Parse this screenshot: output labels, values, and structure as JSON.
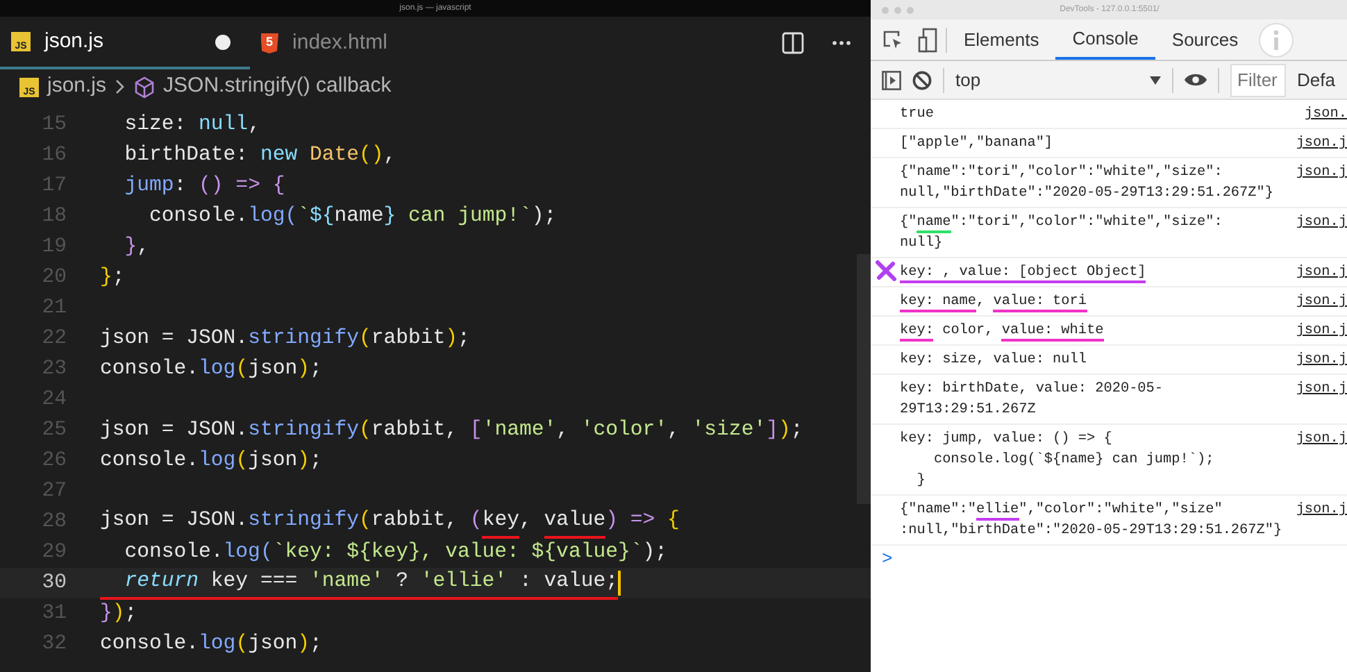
{
  "window": {
    "title": "json.js — javascript"
  },
  "editor": {
    "tabs": [
      {
        "label": "json.js",
        "icon": "JS",
        "selected": true,
        "modified": true
      },
      {
        "label": "index.html",
        "icon": "5",
        "selected": false,
        "modified": false
      }
    ],
    "breadcrumb": [
      {
        "label": "json.js",
        "icon": "JS"
      },
      {
        "label": "JSON.stringify() callback"
      }
    ],
    "lines": [
      {
        "number": "15",
        "current": false,
        "tokens": [
          {
            "text": "  size: ",
            "kind": "plain"
          },
          {
            "text": "null",
            "kind": "const"
          },
          {
            "text": ",",
            "kind": "plain"
          }
        ]
      },
      {
        "number": "16",
        "current": false,
        "tokens": [
          {
            "text": "  birthDate: ",
            "kind": "plain"
          },
          {
            "text": "new ",
            "kind": "const"
          },
          {
            "text": "Date",
            "kind": "cls"
          },
          {
            "text": "()",
            "kind": "brk"
          },
          {
            "text": ",",
            "kind": "plain"
          }
        ]
      },
      {
        "number": "17",
        "current": false,
        "tokens": [
          {
            "text": "  jump",
            "kind": "func"
          },
          {
            "text": ": ",
            "kind": "plain"
          },
          {
            "text": "() => {",
            "kind": "kw"
          }
        ]
      },
      {
        "number": "18",
        "current": false,
        "tokens": [
          {
            "text": "    console.",
            "kind": "plain"
          },
          {
            "text": "log",
            "kind": "func"
          },
          {
            "text": "(",
            "kind": "blue"
          },
          {
            "text": "`",
            "kind": "str"
          },
          {
            "text": "${",
            "kind": "const"
          },
          {
            "text": "name",
            "kind": "plain"
          },
          {
            "text": "}",
            "kind": "const"
          },
          {
            "text": " can jump!`",
            "kind": "str"
          },
          {
            "text": ");",
            "kind": "plain"
          }
        ]
      },
      {
        "number": "19",
        "current": false,
        "tokens": [
          {
            "text": "  }",
            "kind": "kw"
          },
          {
            "text": ",",
            "kind": "plain"
          }
        ]
      },
      {
        "number": "20",
        "current": false,
        "tokens": [
          {
            "text": "}",
            "kind": "brk"
          },
          {
            "text": ";",
            "kind": "plain"
          }
        ]
      },
      {
        "number": "21",
        "current": false
      },
      {
        "number": "22",
        "current": false,
        "tokens": [
          {
            "text": "json = JSON.",
            "kind": "plain"
          },
          {
            "text": "stringify",
            "kind": "func"
          },
          {
            "text": "(",
            "kind": "brk"
          },
          {
            "text": "rabbit",
            "kind": "plain"
          },
          {
            "text": ")",
            "kind": "brk"
          },
          {
            "text": ";",
            "kind": "plain"
          }
        ]
      },
      {
        "number": "23",
        "current": false,
        "tokens": [
          {
            "text": "console.",
            "kind": "plain"
          },
          {
            "text": "log",
            "kind": "func"
          },
          {
            "text": "(",
            "kind": "brk"
          },
          {
            "text": "json",
            "kind": "plain"
          },
          {
            "text": ")",
            "kind": "brk"
          },
          {
            "text": ";",
            "kind": "plain"
          }
        ]
      },
      {
        "number": "24",
        "current": false
      },
      {
        "number": "25",
        "current": false,
        "tokens": [
          {
            "text": "json = JSON.",
            "kind": "plain"
          },
          {
            "text": "stringify",
            "kind": "func"
          },
          {
            "text": "(",
            "kind": "brk"
          },
          {
            "text": "rabbit, ",
            "kind": "plain"
          },
          {
            "text": "[",
            "kind": "kw"
          },
          {
            "text": "'name'",
            "kind": "str"
          },
          {
            "text": ", ",
            "kind": "plain"
          },
          {
            "text": "'color'",
            "kind": "str"
          },
          {
            "text": ", ",
            "kind": "plain"
          },
          {
            "text": "'size'",
            "kind": "str"
          },
          {
            "text": "]",
            "kind": "kw"
          },
          {
            "text": ")",
            "kind": "brk"
          },
          {
            "text": ";",
            "kind": "plain"
          }
        ]
      },
      {
        "number": "26",
        "current": false,
        "tokens": [
          {
            "text": "console.",
            "kind": "plain"
          },
          {
            "text": "log",
            "kind": "func"
          },
          {
            "text": "(",
            "kind": "brk"
          },
          {
            "text": "json",
            "kind": "plain"
          },
          {
            "text": ")",
            "kind": "brk"
          },
          {
            "text": ";",
            "kind": "plain"
          }
        ]
      },
      {
        "number": "27",
        "current": false
      },
      {
        "number": "28",
        "current": false,
        "tokens": [
          {
            "text": "json = JSON.",
            "kind": "plain"
          },
          {
            "text": "stringify",
            "kind": "func"
          },
          {
            "text": "(",
            "kind": "brk"
          },
          {
            "text": "rabbit, ",
            "kind": "plain"
          },
          {
            "text": "(",
            "kind": "kw"
          },
          {
            "text": "key",
            "kind": "plain",
            "color": "#e8141b"
          },
          {
            "text": ", ",
            "kind": "plain"
          },
          {
            "text": "value",
            "kind": "plain",
            "color": "#e8141b"
          },
          {
            "text": ") => ",
            "kind": "kw"
          },
          {
            "text": "{",
            "kind": "brk"
          }
        ]
      },
      {
        "number": "29",
        "current": false,
        "tokens": [
          {
            "text": "  console.",
            "kind": "plain"
          },
          {
            "text": "log",
            "kind": "func"
          },
          {
            "text": "(",
            "kind": "blue"
          },
          {
            "text": "`key: ${key}, value: ${value}`",
            "kind": "str"
          },
          {
            "text": ");",
            "kind": "plain"
          }
        ]
      },
      {
        "number": "30",
        "current": true,
        "color": "#e8141b",
        "tokens": [
          {
            "text": "  return",
            "kind": "ret"
          },
          {
            "text": " key === ",
            "kind": "plain"
          },
          {
            "text": "'name'",
            "kind": "str"
          },
          {
            "text": " ? ",
            "kind": "plain"
          },
          {
            "text": "'ellie'",
            "kind": "str"
          },
          {
            "text": " : value;",
            "kind": "plain"
          }
        ]
      },
      {
        "number": "31",
        "current": false,
        "tokens": [
          {
            "text": "}",
            "kind": "kw"
          },
          {
            "text": ")",
            "kind": "brk"
          },
          {
            "text": ";",
            "kind": "plain"
          }
        ]
      },
      {
        "number": "32",
        "current": false,
        "tokens": [
          {
            "text": "console.",
            "kind": "plain"
          },
          {
            "text": "log",
            "kind": "func"
          },
          {
            "text": "(",
            "kind": "brk"
          },
          {
            "text": "json",
            "kind": "plain"
          },
          {
            "text": ")",
            "kind": "brk"
          },
          {
            "text": ";",
            "kind": "plain"
          }
        ]
      }
    ]
  },
  "devtools": {
    "title": "DevTools - 127.0.0.1:5501/",
    "tabs": [
      {
        "label": "Elements",
        "selected": false
      },
      {
        "label": "Console",
        "selected": true
      },
      {
        "label": "Sources",
        "selected": false
      }
    ],
    "context": "top",
    "filter": {
      "placeholder": "Filter"
    },
    "levels": "Defa",
    "messages": [
      {
        "marked": false,
        "source": "json.",
        "lines": [
          [
            {
              "text": "true"
            }
          ]
        ]
      },
      {
        "marked": false,
        "source": "json.j",
        "lines": [
          [
            {
              "text": "[\"apple\",\"banana\"]"
            }
          ]
        ]
      },
      {
        "marked": false,
        "source": "json.j",
        "lines": [
          [
            {
              "text": "{\"name\":\"tori\",\"color\":\"white\",\"size\":"
            }
          ],
          [
            {
              "text": "null,\"birthDate\":\"2020-05-29T13:29:51.267Z\"}"
            }
          ]
        ]
      },
      {
        "marked": false,
        "source": "json.j",
        "lines": [
          [
            {
              "text": "{\""
            },
            {
              "text": "name",
              "color": "#2ee06a"
            },
            {
              "text": "\":\"tori\",\"color\":\"white\",\"size\":"
            }
          ],
          [
            {
              "text": "null}"
            }
          ]
        ]
      },
      {
        "marked": true,
        "source": "json.j",
        "lines": [
          [
            {
              "text": "key: , value: [object Object]",
              "color": "#c43cf0"
            }
          ]
        ]
      },
      {
        "marked": false,
        "source": "json.j",
        "lines": [
          [
            {
              "text": "key: name",
              "color": "#f032c8"
            },
            {
              "text": ", "
            },
            {
              "text": "value: tori",
              "color": "#f032c8"
            }
          ]
        ]
      },
      {
        "marked": false,
        "source": "json.j",
        "lines": [
          [
            {
              "text": "key:",
              "color": "#f032c8"
            },
            {
              "text": " color, "
            },
            {
              "text": "value: white",
              "color": "#f032c8"
            }
          ]
        ]
      },
      {
        "marked": false,
        "source": "json.j",
        "lines": [
          [
            {
              "text": "key: size, value: null"
            }
          ]
        ]
      },
      {
        "marked": false,
        "source": "json.j",
        "lines": [
          [
            {
              "text": "key: birthDate, value: 2020-05-"
            }
          ],
          [
            {
              "text": "29T13:29:51.267Z"
            }
          ]
        ]
      },
      {
        "marked": false,
        "source": "json.j",
        "lines": [
          [
            {
              "text": "key: jump, value: () => {"
            }
          ],
          [
            {
              "text": "    console.log(`${name} can jump!`);"
            }
          ],
          [
            {
              "text": "  }"
            }
          ]
        ]
      },
      {
        "marked": false,
        "source": "json.j",
        "lines": [
          [
            {
              "text": "{\"name\":\""
            },
            {
              "text": "ellie",
              "color": "#c43cf0"
            },
            {
              "text": "\",\"color\":\"white\",\"size\""
            }
          ],
          [
            {
              "text": ":null,\"birthDate\":\"2020-05-29T13:29:51.267Z\"}"
            }
          ]
        ]
      }
    ],
    "prompt": ">"
  }
}
